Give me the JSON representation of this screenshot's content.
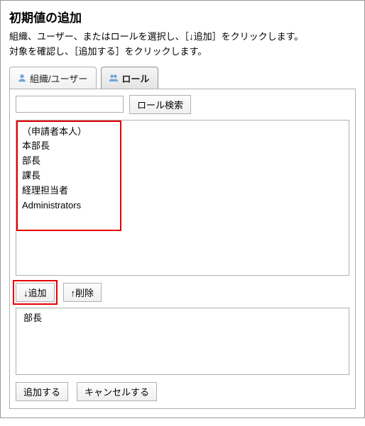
{
  "title": "初期値の追加",
  "description_line1": "組織、ユーザー、またはロールを選択し、［↓追加］をクリックします。",
  "description_line2": "対象を確認し、［追加する］をクリックします。",
  "tabs": {
    "org_user": "組織/ユーザー",
    "role": "ロール"
  },
  "search": {
    "placeholder": "",
    "button": "ロール検索"
  },
  "role_list": [
    "（申請者本人）",
    "本部長",
    "部長",
    "課長",
    "経理担当者",
    "Administrators"
  ],
  "buttons": {
    "add": "↓追加",
    "remove": "↑削除",
    "submit": "追加する",
    "cancel": "キャンセルする"
  },
  "selected": [
    "部長"
  ]
}
